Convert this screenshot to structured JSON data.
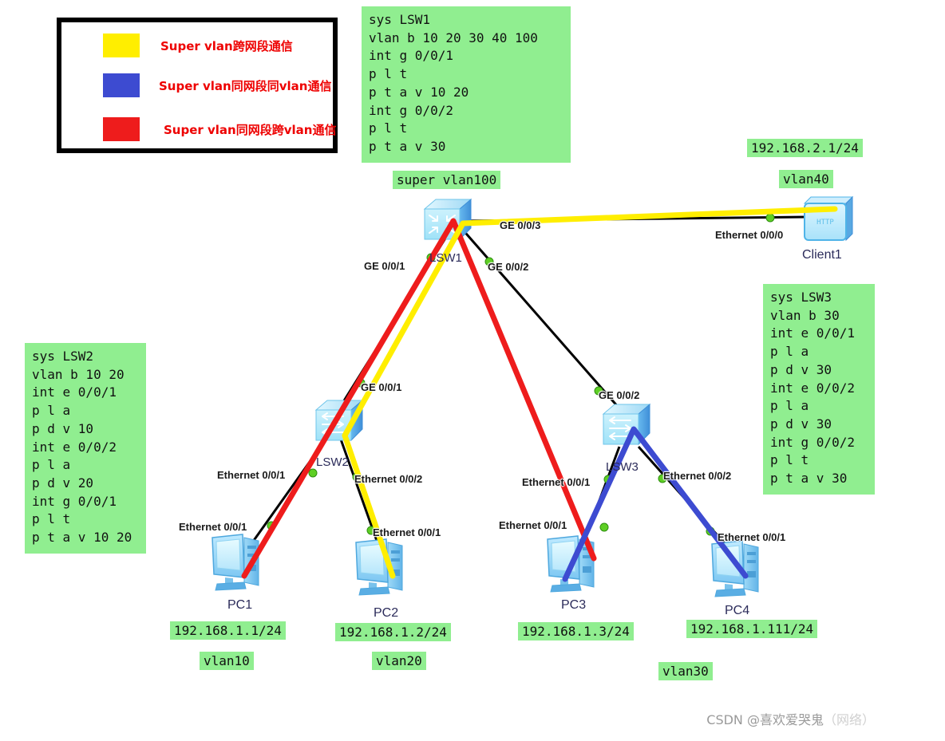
{
  "legend": {
    "items": [
      {
        "color": "#ffee00",
        "label": "Super vlan跨网段通信",
        "name": "legend-yellow"
      },
      {
        "color": "#3d4bd1",
        "label": "Super vlan同网段同vlan通信",
        "name": "legend-blue"
      },
      {
        "color": "#ee1c1c",
        "label": "Super vlan同网段跨vlan通信",
        "name": "legend-red"
      }
    ]
  },
  "configs": {
    "lsw1": "sys LSW1\nvlan b 10 20 30 40 100\nint g 0/0/1\np l t\np t a v 10 20\nint g 0/0/2\np l t\np t a v 30",
    "lsw2": "sys LSW2\nvlan b 10 20\nint e 0/0/1\np l a\np d v 10\nint e 0/0/2\np l a\np d v 20\nint g 0/0/1\np l t\np t a v 10 20",
    "lsw3": "sys LSW3\nvlan b 30\nint e 0/0/1\np l a\np d v 30\nint e 0/0/2\np l a\np d v 30\nint g 0/0/2\np l t\np t a v 30"
  },
  "tags": {
    "super_vlan": "super vlan100",
    "client1_ip": "192.168.2.1/24",
    "client1_vlan": "vlan40",
    "pc1_ip": "192.168.1.1/24",
    "pc1_vlan": "vlan10",
    "pc2_ip": "192.168.1.2/24",
    "pc2_vlan": "vlan20",
    "pc3_ip": "192.168.1.3/24",
    "pc4_ip": "192.168.1.111/24",
    "pc34_vlan": "vlan30"
  },
  "devices": {
    "lsw1": "LSW1",
    "lsw2": "LSW2",
    "lsw3": "LSW3",
    "client1": "Client1",
    "pc1": "PC1",
    "pc2": "PC2",
    "pc3": "PC3",
    "pc4": "PC4",
    "client1_badge": "HTTP"
  },
  "ports": {
    "lsw1_ge1": "GE 0/0/1",
    "lsw1_ge2": "GE 0/0/2",
    "lsw1_ge3": "GE 0/0/3",
    "lsw2_ge1": "GE 0/0/1",
    "lsw2_e1": "Ethernet 0/0/1",
    "lsw2_e2": "Ethernet 0/0/2",
    "lsw3_ge2": "GE 0/0/2",
    "lsw3_e1": "Ethernet 0/0/1",
    "lsw3_e2": "Ethernet 0/0/2",
    "client1_e0": "Ethernet 0/0/0",
    "pc1_e1": "Ethernet 0/0/1",
    "pc2_e1": "Ethernet 0/0/1",
    "pc3_e1": "Ethernet 0/0/1",
    "pc4_e1": "Ethernet 0/0/1"
  },
  "watermark": {
    "prefix": "CSDN @喜欢爱哭鬼",
    "suffix": "（网络）"
  },
  "colors": {
    "yellow": "#ffee00",
    "blue": "#3d4bd1",
    "red": "#ee1c1c",
    "link": "#000000",
    "node_dot": "#55cc22",
    "tag_bg": "#90ee90"
  }
}
